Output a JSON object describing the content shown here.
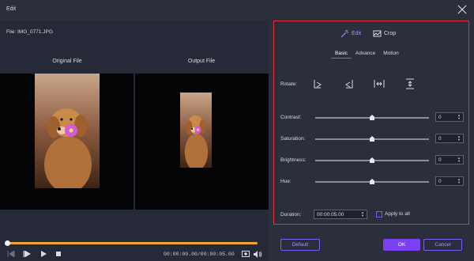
{
  "window": {
    "title": "Edit"
  },
  "file": {
    "label": "File: IMG_0771.JPG"
  },
  "preview": {
    "original_title": "Original File",
    "output_title": "Output File"
  },
  "player": {
    "timecode": "00:00:00.00/00:00:05.00",
    "progress": 1.0
  },
  "panel": {
    "mode_tabs": {
      "edit": "Edit",
      "crop": "Crop"
    },
    "subtabs": {
      "basic": "Basic",
      "advance": "Advance",
      "motion": "Motion",
      "active": "Basic"
    },
    "rotate_label": "Rotate:",
    "adjustments": [
      {
        "label": "Contrast:",
        "value": "0",
        "level": 0.5
      },
      {
        "label": "Saturation:",
        "value": "0",
        "level": 0.5
      },
      {
        "label": "Brightness:",
        "value": "0",
        "level": 0.5
      },
      {
        "label": "Hue:",
        "value": "0",
        "level": 0.5
      }
    ],
    "duration_label": "Duration:",
    "duration_value": "00:00:05.00",
    "apply_all_label": "Apply to all"
  },
  "buttons": {
    "default": "Default",
    "ok": "OK",
    "cancel": "Cancel"
  },
  "colors": {
    "accent": "#7b5cf5",
    "highlight_border": "#e2333a",
    "progress": "#f2a33a"
  }
}
